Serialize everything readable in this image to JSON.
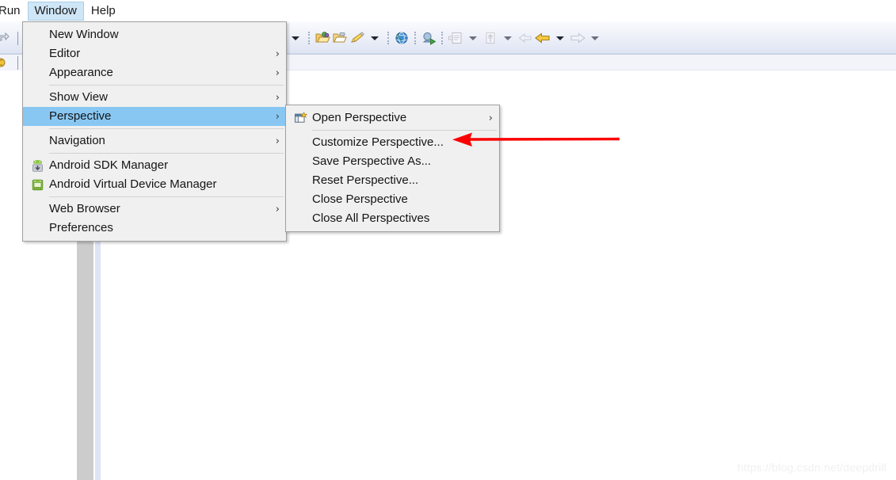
{
  "app": {
    "watermark": "https://blog.csdn.net/deepdrill",
    "accent_selected": "#89c7f3",
    "accent_menubar_active": "#cfe6f7",
    "annotation_color": "#ff0000",
    "menu_background": "#f0f0f0"
  },
  "menubar": {
    "items": [
      {
        "label": "Run",
        "state": "clipped"
      },
      {
        "label": "Window",
        "state": "active"
      },
      {
        "label": "Help",
        "state": "normal"
      }
    ]
  },
  "toolbar": {
    "left_buttons": [
      {
        "name": "step-return-icon",
        "label": "Step Return"
      },
      {
        "name": "resume-icon",
        "label": "Resume"
      },
      {
        "name": "debug-icon",
        "label": "Debug"
      }
    ],
    "buttons": [
      {
        "name": "dropdown-caret",
        "label": "More"
      },
      {
        "name": "open-type-icon",
        "label": "Open Type"
      },
      {
        "name": "open-resource-icon",
        "label": "Open Resource"
      },
      {
        "name": "highlight-pen-icon",
        "label": "Annotate"
      },
      {
        "name": "dropdown-caret",
        "label": "More"
      },
      {
        "name": "open-web-browser-icon",
        "label": "Open Web Browser"
      },
      {
        "name": "run-android-icon",
        "label": "Run Android Application"
      },
      {
        "name": "new-java-class-icon",
        "label": "New Java Class"
      },
      {
        "name": "dropdown-caret",
        "label": "More"
      },
      {
        "name": "next-annotation-icon",
        "label": "Next Annotation"
      },
      {
        "name": "dropdown-caret",
        "label": "More"
      },
      {
        "name": "back-small-icon",
        "label": "Back"
      },
      {
        "name": "back-icon",
        "label": "Back"
      },
      {
        "name": "dropdown-caret",
        "label": "More"
      },
      {
        "name": "forward-icon",
        "label": "Forward"
      },
      {
        "name": "dropdown-caret",
        "label": "More"
      }
    ]
  },
  "window_menu": {
    "title": "Window",
    "groups": [
      {
        "items": [
          {
            "label": "New Window",
            "icon": null,
            "submenu": false,
            "selected": false
          },
          {
            "label": "Editor",
            "icon": null,
            "submenu": true,
            "selected": false
          },
          {
            "label": "Appearance",
            "icon": null,
            "submenu": true,
            "selected": false
          }
        ]
      },
      {
        "items": [
          {
            "label": "Show View",
            "icon": null,
            "submenu": true,
            "selected": false
          },
          {
            "label": "Perspective",
            "icon": null,
            "submenu": true,
            "selected": true
          }
        ]
      },
      {
        "items": [
          {
            "label": "Navigation",
            "icon": null,
            "submenu": true,
            "selected": false
          }
        ]
      },
      {
        "items": [
          {
            "label": "Android SDK Manager",
            "icon": "android-sdk-manager-icon",
            "submenu": false,
            "selected": false
          },
          {
            "label": "Android Virtual Device Manager",
            "icon": "android-avd-manager-icon",
            "submenu": false,
            "selected": false
          }
        ]
      },
      {
        "items": [
          {
            "label": "Web Browser",
            "icon": null,
            "submenu": true,
            "selected": false
          },
          {
            "label": "Preferences",
            "icon": null,
            "submenu": false,
            "selected": false
          }
        ]
      }
    ]
  },
  "perspective_menu": {
    "title": "Perspective",
    "groups": [
      {
        "items": [
          {
            "label": "Open Perspective",
            "icon": "open-perspective-icon",
            "submenu": true,
            "selected": false
          }
        ]
      },
      {
        "items": [
          {
            "label": "Customize Perspective...",
            "icon": null,
            "submenu": false,
            "selected": false,
            "annotated": true
          },
          {
            "label": "Save Perspective As...",
            "icon": null,
            "submenu": false,
            "selected": false
          },
          {
            "label": "Reset Perspective...",
            "icon": null,
            "submenu": false,
            "selected": false
          },
          {
            "label": "Close Perspective",
            "icon": null,
            "submenu": false,
            "selected": false
          },
          {
            "label": "Close All Perspectives",
            "icon": null,
            "submenu": false,
            "selected": false
          }
        ]
      }
    ]
  }
}
